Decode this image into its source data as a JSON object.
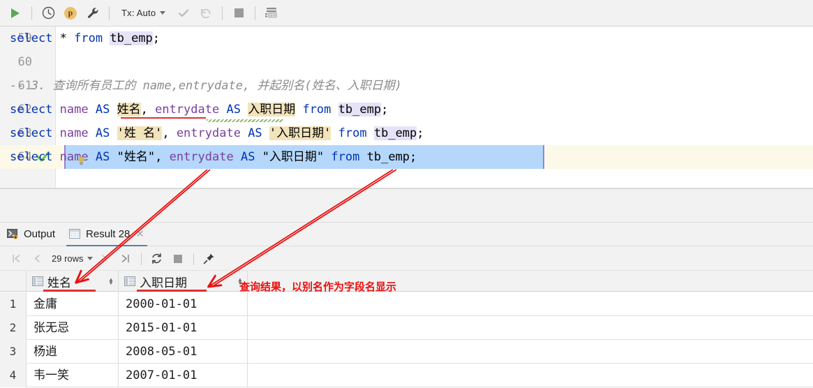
{
  "toolbar": {
    "run_label": "run-query",
    "history_label": "history",
    "profile_label": "p",
    "settings_label": "settings",
    "tx_label": "Tx: Auto",
    "commit_label": "commit",
    "rollback_label": "rollback",
    "stop_label": "stop",
    "data_label": "open-data-editor"
  },
  "editor": {
    "lines": [
      {
        "num": "59",
        "tokens": [
          {
            "t": "select",
            "c": "kw"
          },
          {
            "t": " ",
            "c": "plain"
          },
          {
            "t": "*",
            "c": "punct"
          },
          {
            "t": " ",
            "c": "plain"
          },
          {
            "t": "from",
            "c": "kw"
          },
          {
            "t": " ",
            "c": "plain"
          },
          {
            "t": "tb_emp",
            "c": "hl-ident"
          },
          {
            "t": ";",
            "c": "punct"
          }
        ]
      },
      {
        "num": "60",
        "tokens": []
      },
      {
        "num": "61",
        "tokens": [
          {
            "t": "-- 3. 查询所有员工的 name,entrydate, 并起别名(姓名、入职日期)",
            "c": "cmt"
          }
        ]
      },
      {
        "num": "62",
        "tokens": [
          {
            "t": "select",
            "c": "kw"
          },
          {
            "t": " ",
            "c": "plain"
          },
          {
            "t": "name",
            "c": "fn"
          },
          {
            "t": " ",
            "c": "plain"
          },
          {
            "t": "AS",
            "c": "kw"
          },
          {
            "t": " ",
            "c": "plain"
          },
          {
            "t": "姓名",
            "c": "hl-alias"
          },
          {
            "t": ", ",
            "c": "punct"
          },
          {
            "t": "entrydate",
            "c": "fn"
          },
          {
            "t": " ",
            "c": "plain"
          },
          {
            "t": "AS",
            "c": "kw"
          },
          {
            "t": " ",
            "c": "plain"
          },
          {
            "t": "入职日期",
            "c": "hl-alias"
          },
          {
            "t": " ",
            "c": "plain"
          },
          {
            "t": "from",
            "c": "kw"
          },
          {
            "t": " ",
            "c": "plain"
          },
          {
            "t": "tb_emp",
            "c": "hl-ident"
          },
          {
            "t": ";",
            "c": "punct"
          }
        ]
      },
      {
        "num": "63",
        "tokens": [
          {
            "t": "select",
            "c": "kw"
          },
          {
            "t": " ",
            "c": "plain"
          },
          {
            "t": "name",
            "c": "fn"
          },
          {
            "t": " ",
            "c": "plain"
          },
          {
            "t": "AS",
            "c": "kw"
          },
          {
            "t": " ",
            "c": "plain"
          },
          {
            "t": "'姓 名'",
            "c": "hl-alias"
          },
          {
            "t": ", ",
            "c": "punct"
          },
          {
            "t": "entrydate",
            "c": "fn"
          },
          {
            "t": " ",
            "c": "plain"
          },
          {
            "t": "AS",
            "c": "kw"
          },
          {
            "t": " ",
            "c": "plain"
          },
          {
            "t": "'入职日期'",
            "c": "hl-alias"
          },
          {
            "t": " ",
            "c": "plain"
          },
          {
            "t": "from",
            "c": "kw"
          },
          {
            "t": " ",
            "c": "plain"
          },
          {
            "t": "tb_emp",
            "c": "hl-ident"
          },
          {
            "t": ";",
            "c": "punct"
          }
        ]
      },
      {
        "num": "64",
        "has_check": true,
        "tokens": [
          {
            "t": "select",
            "c": "kw"
          },
          {
            "t": " ",
            "c": "plain"
          },
          {
            "t": "name",
            "c": "fn"
          },
          {
            "t": " ",
            "c": "plain"
          },
          {
            "t": "AS",
            "c": "kw"
          },
          {
            "t": " ",
            "c": "plain"
          },
          {
            "t": "\"姓名\"",
            "c": "plain"
          },
          {
            "t": ", ",
            "c": "punct"
          },
          {
            "t": "entrydate",
            "c": "fn"
          },
          {
            "t": " ",
            "c": "plain"
          },
          {
            "t": "AS",
            "c": "kw"
          },
          {
            "t": " ",
            "c": "plain"
          },
          {
            "t": "\"入职日期\"",
            "c": "plain"
          },
          {
            "t": " ",
            "c": "plain"
          },
          {
            "t": "from",
            "c": "kw"
          },
          {
            "t": " ",
            "c": "plain"
          },
          {
            "t": "tb_emp",
            "c": "plain"
          },
          {
            "t": ";",
            "c": "punct"
          }
        ]
      }
    ],
    "line_59_text": "select * from tb_emp;",
    "line_61_text": "-- 3. 查询所有员工的 name,entrydate, 并起别名(姓名、入职日期)",
    "line_62_text": "select name AS 姓名, entrydate AS 入职日期 from tb_emp;",
    "line_63_text": "select name AS '姓 名', entrydate AS '入职日期' from tb_emp;",
    "line_64_text": "select name AS \"姓名\", entrydate AS \"入职日期\" from tb_emp;"
  },
  "panel": {
    "tabs": [
      {
        "label": "Output",
        "icon": "console-icon",
        "active": false,
        "closable": false
      },
      {
        "label": "Result 28",
        "icon": "table-icon",
        "active": true,
        "closable": true
      }
    ],
    "grid_toolbar": {
      "first_page": "|<",
      "prev_page": "<",
      "rows_label": "29 rows",
      "next_page": ">",
      "last_page": ">|",
      "refresh": "refresh",
      "stop": "stop",
      "pin": "pin"
    }
  },
  "result_grid": {
    "columns": [
      {
        "name": "姓名"
      },
      {
        "name": "入职日期"
      }
    ],
    "rows": [
      {
        "idx": "1",
        "name": "金庸",
        "entrydate": "2000-01-01"
      },
      {
        "idx": "2",
        "name": "张无忌",
        "entrydate": "2015-01-01"
      },
      {
        "idx": "3",
        "name": "杨逍",
        "entrydate": "2008-05-01"
      },
      {
        "idx": "4",
        "name": "韦一笑",
        "entrydate": "2007-01-01"
      }
    ]
  },
  "annotations": {
    "result_note": "查询结果，以别名作为字段名显示",
    "color": "#e81010"
  },
  "colors": {
    "keyword": "#0033b3",
    "function": "#7a3e9d",
    "comment": "#8c8c8c",
    "alias_highlight": "#f2e3bb",
    "ident_highlight": "#e6e2f7",
    "selection": "#b4d7fb",
    "current_line": "#fcf9e8",
    "annotation_red": "#e81010",
    "accent_green": "#5aa85a"
  }
}
